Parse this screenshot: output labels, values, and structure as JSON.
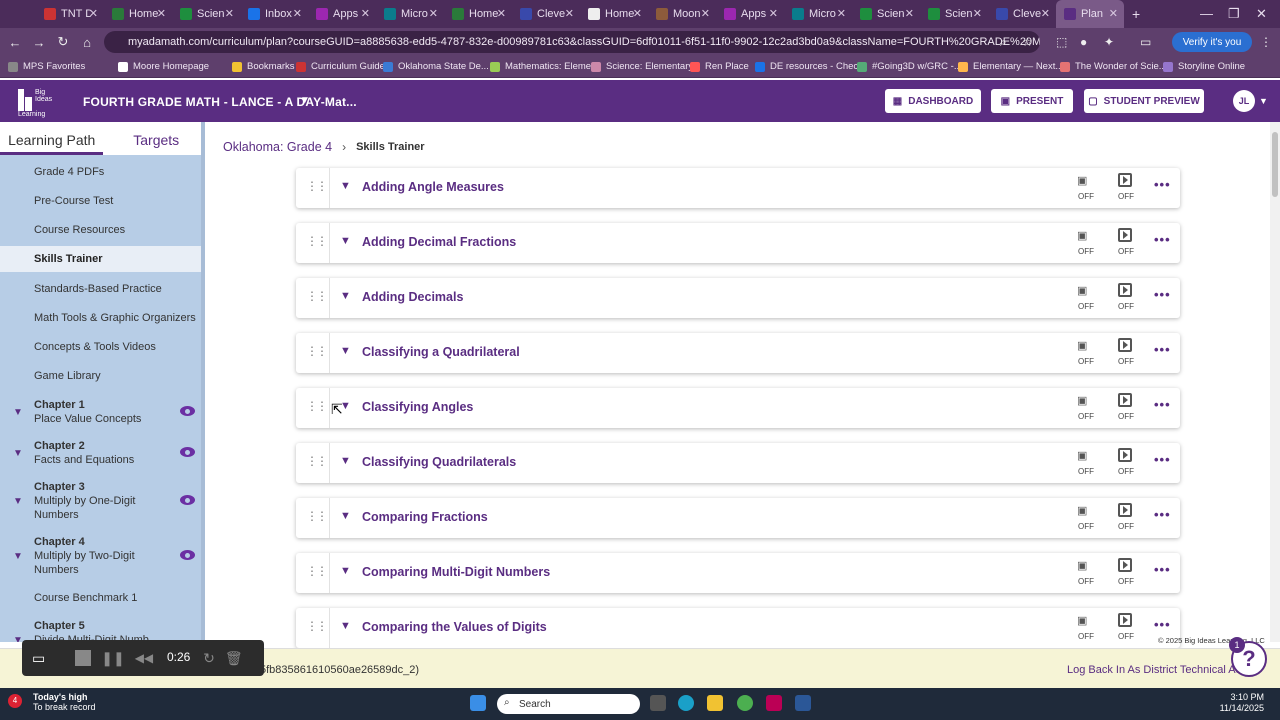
{
  "browser": {
    "tabs": [
      {
        "label": "TNT D",
        "color": "#c33"
      },
      {
        "label": "Home",
        "color": "#2a7a3a"
      },
      {
        "label": "Scien",
        "color": "#1e8e3e"
      },
      {
        "label": "Inbox",
        "color": "#1a73e8"
      },
      {
        "label": "Apps",
        "color": "#9c27b0"
      },
      {
        "label": "Micro",
        "color": "#0a7c8c"
      },
      {
        "label": "Home",
        "color": "#2a7a3a"
      },
      {
        "label": "Cleve",
        "color": "#3949ab"
      },
      {
        "label": "Home",
        "color": "#eee"
      },
      {
        "label": "Moon",
        "color": "#8d5b3b"
      },
      {
        "label": "Apps",
        "color": "#9c27b0"
      },
      {
        "label": "Micro",
        "color": "#0a7c8c"
      },
      {
        "label": "Scien",
        "color": "#1e8e3e"
      },
      {
        "label": "Scien",
        "color": "#1e8e3e"
      },
      {
        "label": "Cleve",
        "color": "#3949ab"
      },
      {
        "label": "Plan",
        "color": "#5a2d82"
      }
    ],
    "url": "myadamath.com/curriculum/plan?courseGUID=a8885638-edd5-4787-832e-d00989781c63&classGUID=6df01011-6f51-11f0-9902-12c2ad3bd0a9&className=FOURTH%20GRADE%20MATH%20-%20LANCE%...",
    "verify_label": "Verify it's you",
    "bookmarks": [
      "MPS Favorites",
      "Moore Homepage",
      "Bookmarks",
      "Curriculum Guides",
      "Oklahoma State De...",
      "Mathematics: Eleme...",
      "Science: Elementary...",
      "Ren Place",
      "DE resources - Chec...",
      "#Going3D w/GRC -...",
      "Elementary — Next...",
      "The Wonder of Scie...",
      "Storyline Online"
    ]
  },
  "header": {
    "logo_text": "Big Ideas Learning",
    "course_title": "FOURTH GRADE MATH - LANCE - A DAY-Mat...",
    "dashboard_label": "DASHBOARD",
    "present_label": "PRESENT",
    "student_preview_label": "STUDENT PREVIEW",
    "avatar_initials": "JL"
  },
  "sidebar": {
    "tab_learning_path": "Learning Path",
    "tab_targets": "Targets",
    "items": [
      "Grade 4 PDFs",
      "Pre-Course Test",
      "Course Resources",
      "Skills Trainer",
      "Standards-Based Practice",
      "Math Tools & Graphic Organizers",
      "Concepts & Tools Videos",
      "Game Library"
    ],
    "chapters": [
      {
        "num": "Chapter 1",
        "name": "Place Value Concepts"
      },
      {
        "num": "Chapter 2",
        "name": "Facts and Equations"
      },
      {
        "num": "Chapter 3",
        "name": "Multiply by One-Digit",
        "name2": "Numbers"
      },
      {
        "num": "Chapter 4",
        "name": "Multiply by Two-Digit",
        "name2": "Numbers"
      }
    ],
    "benchmark": "Course Benchmark 1",
    "chapter5": "Chapter 5",
    "chapter5_partial": "Divide Multi-Digit Numb..."
  },
  "main": {
    "breadcrumb_root": "Oklahoma: Grade 4",
    "breadcrumb_current": "Skills Trainer",
    "off_label": "OFF",
    "skills": [
      "Adding Angle Measures",
      "Adding Decimal Fractions",
      "Adding Decimals",
      "Classifying a Quadrilateral",
      "Classifying Angles",
      "Classifying Quadrilaterals",
      "Comparing Fractions",
      "Comparing Multi-Digit Numbers",
      "Comparing the Values of Digits"
    ],
    "copyright": "© 2025 Big Ideas Learning, LLC"
  },
  "banner": {
    "id_text": "5fb835861610560ae26589dc_2)",
    "link": "Log Back In As District Technical Admin",
    "recorder_time": "0:26"
  },
  "help_badge": "1",
  "taskbar": {
    "weather_line1": "Today's high",
    "weather_line2": "To break record",
    "weather_badge": "4",
    "search_placeholder": "Search",
    "time": "3:10 PM",
    "date": "11/14/2025"
  }
}
